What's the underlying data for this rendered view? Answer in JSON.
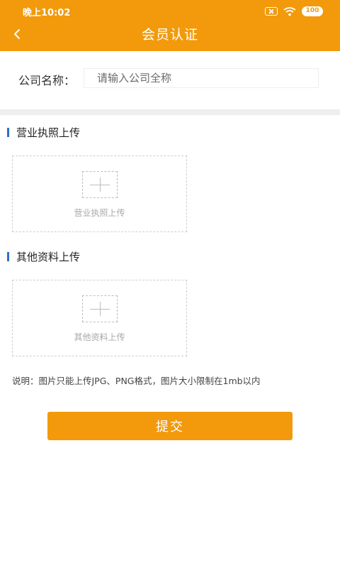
{
  "status_bar": {
    "time": "晚上10:02",
    "battery": "100",
    "icons": [
      "sim-x-icon",
      "wifi-icon",
      "battery-icon"
    ]
  },
  "nav": {
    "title": "会员认证",
    "back_icon": "chevron-left-icon"
  },
  "company": {
    "label": "公司名称：",
    "placeholder": "请输入公司全称",
    "value": ""
  },
  "sections": {
    "license": {
      "title": "营业执照上传",
      "upload_text": "营业执照上传"
    },
    "other": {
      "title": "其他资料上传",
      "upload_text": "其他资料上传"
    }
  },
  "note": "说明：图片只能上传JPG、PNG格式，图片大小限制在1mb以内",
  "submit_label": "提交",
  "colors": {
    "accent": "#F29A0C",
    "section_marker": "#2E6FC4",
    "divider": "#EEEEEE"
  }
}
